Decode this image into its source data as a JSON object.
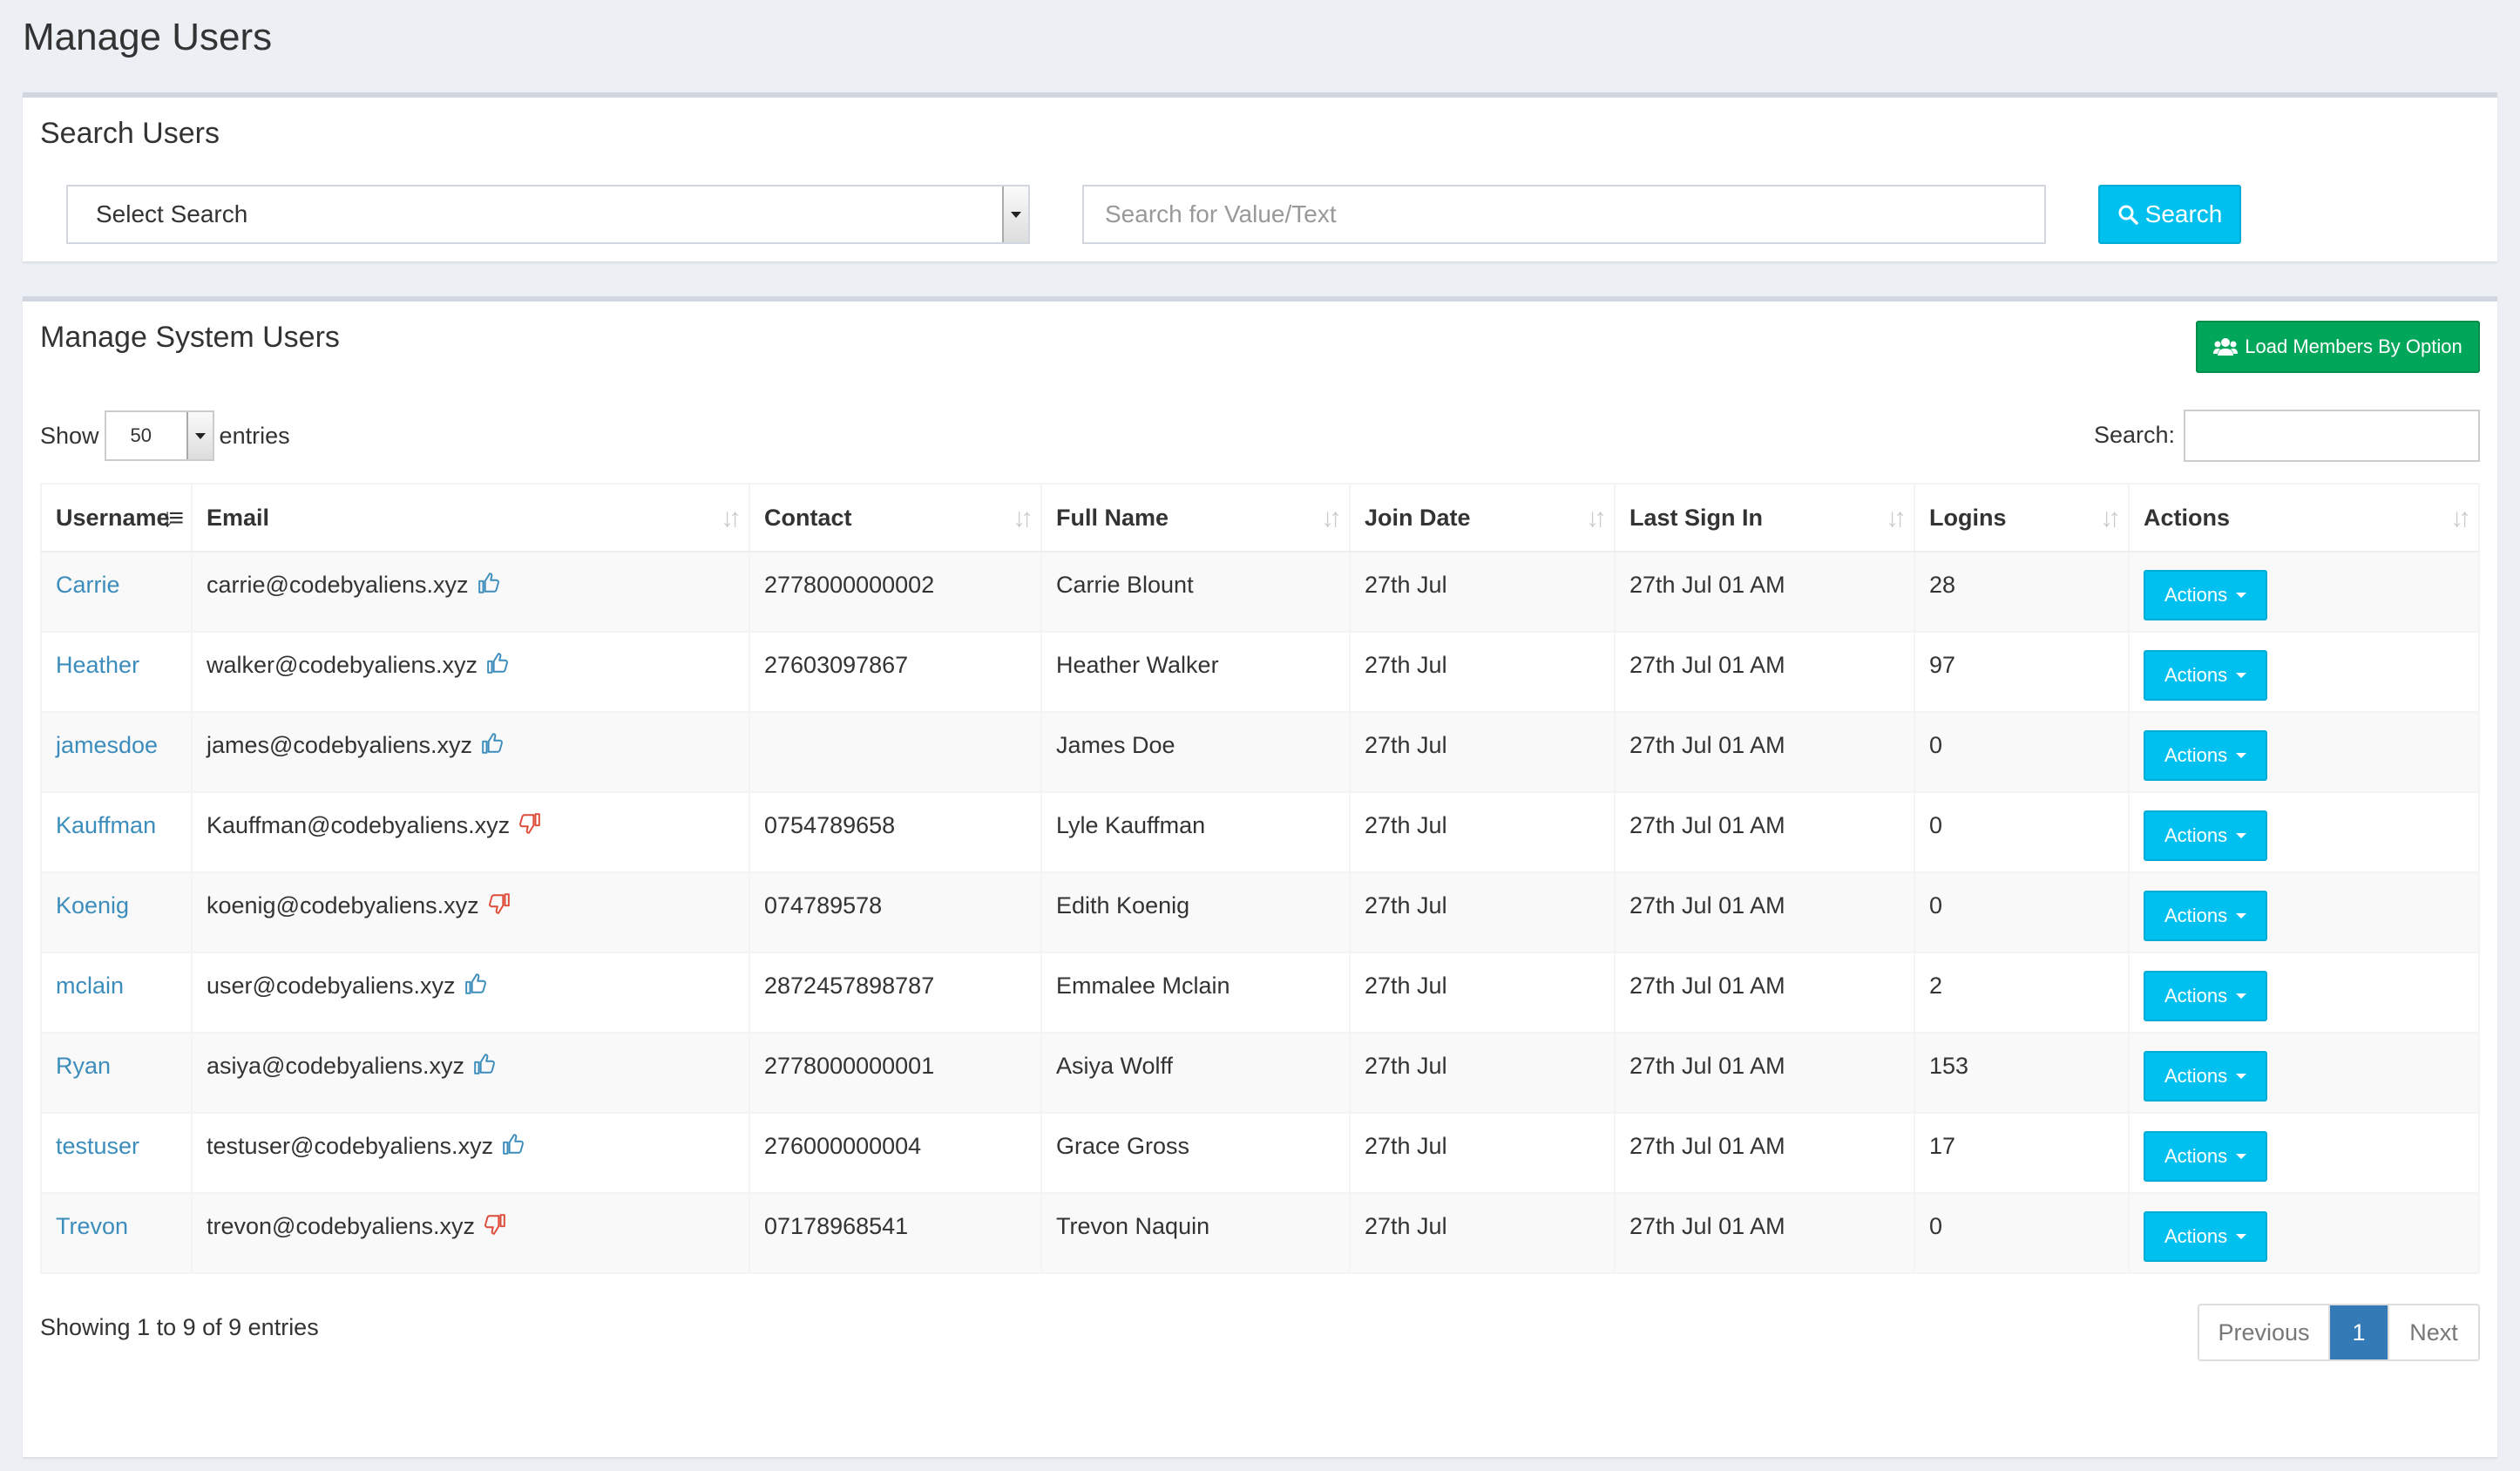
{
  "page": {
    "title": "Manage Users"
  },
  "search_panel": {
    "title": "Search Users",
    "select_value": "Select Search",
    "input_placeholder": "Search for Value/Text",
    "search_button": "Search"
  },
  "users_panel": {
    "title": "Manage System Users",
    "load_button": "Load Members By Option",
    "show_label": "Show",
    "entries_value": "50",
    "entries_label": "entries",
    "search_label": "Search:",
    "columns": [
      "Username",
      "Email",
      "Contact",
      "Full Name",
      "Join Date",
      "Last Sign In",
      "Logins",
      "Actions"
    ],
    "rows": [
      {
        "username": "Carrie",
        "email": "carrie@codebyaliens.xyz",
        "thumb": "up",
        "contact": "2778000000002",
        "full_name": "Carrie Blount",
        "join": "27th Jul",
        "last": "27th Jul 01 AM",
        "logins": "28",
        "action": "Actions"
      },
      {
        "username": "Heather",
        "email": "walker@codebyaliens.xyz",
        "thumb": "up",
        "contact": "27603097867",
        "full_name": "Heather Walker",
        "join": "27th Jul",
        "last": "27th Jul 01 AM",
        "logins": "97",
        "action": "Actions"
      },
      {
        "username": "jamesdoe",
        "email": "james@codebyaliens.xyz",
        "thumb": "up",
        "contact": "",
        "full_name": "James Doe",
        "join": "27th Jul",
        "last": "27th Jul 01 AM",
        "logins": "0",
        "action": "Actions"
      },
      {
        "username": "Kauffman",
        "email": "Kauffman@codebyaliens.xyz",
        "thumb": "down",
        "contact": "0754789658",
        "full_name": "Lyle Kauffman",
        "join": "27th Jul",
        "last": "27th Jul 01 AM",
        "logins": "0",
        "action": "Actions"
      },
      {
        "username": "Koenig",
        "email": "koenig@codebyaliens.xyz",
        "thumb": "down",
        "contact": "074789578",
        "full_name": "Edith Koenig",
        "join": "27th Jul",
        "last": "27th Jul 01 AM",
        "logins": "0",
        "action": "Actions"
      },
      {
        "username": "mclain",
        "email": "user@codebyaliens.xyz",
        "thumb": "up",
        "contact": "2872457898787",
        "full_name": "Emmalee Mclain",
        "join": "27th Jul",
        "last": "27th Jul 01 AM",
        "logins": "2",
        "action": "Actions"
      },
      {
        "username": "Ryan",
        "email": "asiya@codebyaliens.xyz",
        "thumb": "up",
        "contact": "2778000000001",
        "full_name": "Asiya Wolff",
        "join": "27th Jul",
        "last": "27th Jul 01 AM",
        "logins": "153",
        "action": "Actions"
      },
      {
        "username": "testuser",
        "email": "testuser@codebyaliens.xyz",
        "thumb": "up",
        "contact": "276000000004",
        "full_name": "Grace Gross",
        "join": "27th Jul",
        "last": "27th Jul 01 AM",
        "logins": "17",
        "action": "Actions"
      },
      {
        "username": "Trevon",
        "email": "trevon@codebyaliens.xyz",
        "thumb": "down",
        "contact": "07178968541",
        "full_name": "Trevon Naquin",
        "join": "27th Jul",
        "last": "27th Jul 01 AM",
        "logins": "0",
        "action": "Actions"
      }
    ],
    "info": "Showing 1 to 9 of 9 entries",
    "pagination": {
      "previous": "Previous",
      "current": "1",
      "next": "Next"
    }
  },
  "colors": {
    "link": "#3c8dbc",
    "info_button": "#00c0ef",
    "success_button": "#00a65a",
    "thumb_up": "#3c8dbc",
    "thumb_down": "#dd4b39",
    "page_active": "#337ab7"
  }
}
